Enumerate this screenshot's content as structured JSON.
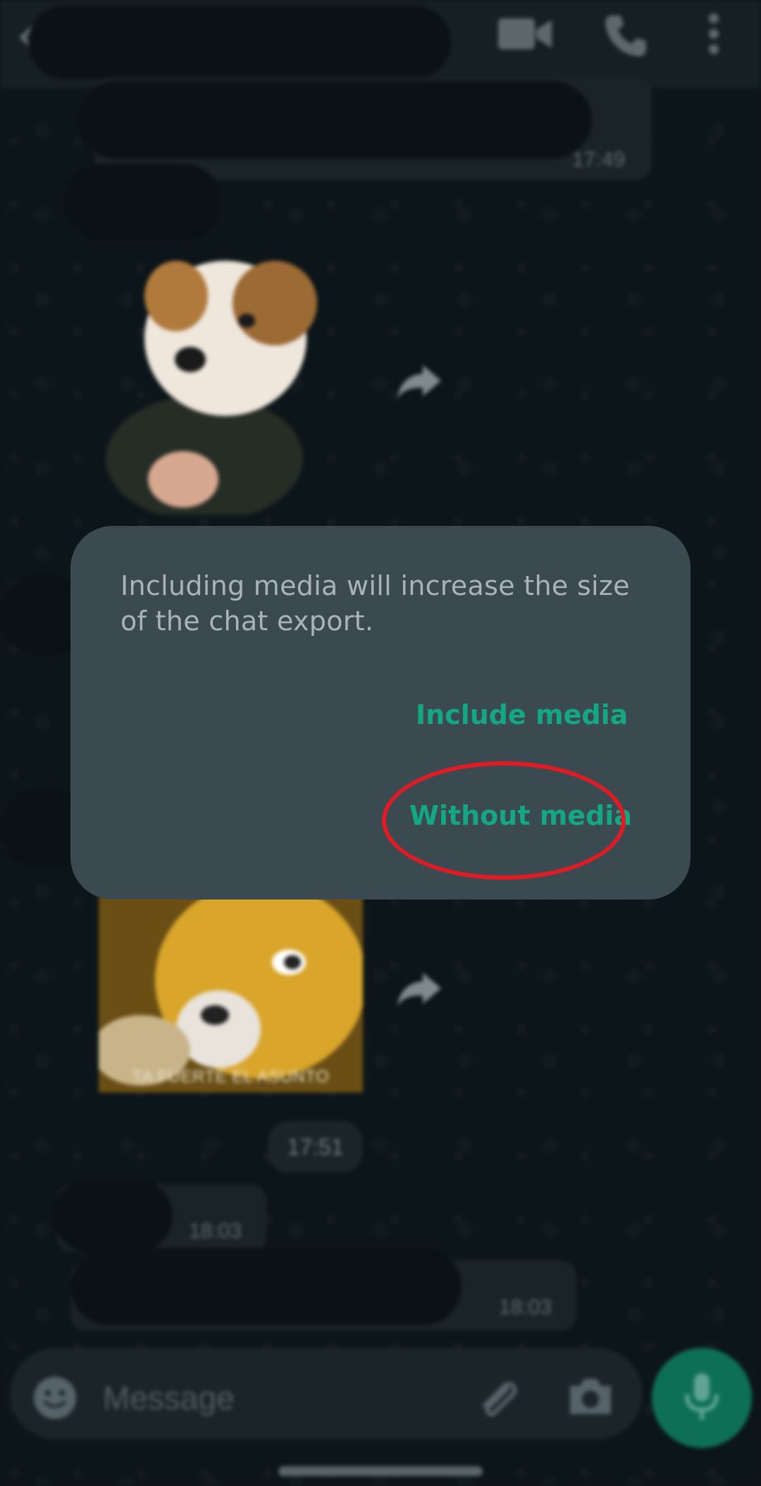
{
  "dialog": {
    "message": "Including media will increase the size of the chat export.",
    "include_label": "Include media",
    "without_label": "Without media",
    "accent_color": "#14a784",
    "highlight_color": "#e01b24"
  },
  "chat": {
    "times": [
      "17:49",
      "17:51",
      "18:03",
      "18:03"
    ],
    "sticker_caption": "TA FUERTE EL ASUNTO"
  },
  "composer": {
    "placeholder": "Message"
  },
  "icons": [
    "back-icon",
    "video-call-icon",
    "phone-icon",
    "more-options-icon",
    "forward-icon",
    "emoji-icon",
    "attach-icon",
    "camera-icon",
    "mic-icon"
  ]
}
